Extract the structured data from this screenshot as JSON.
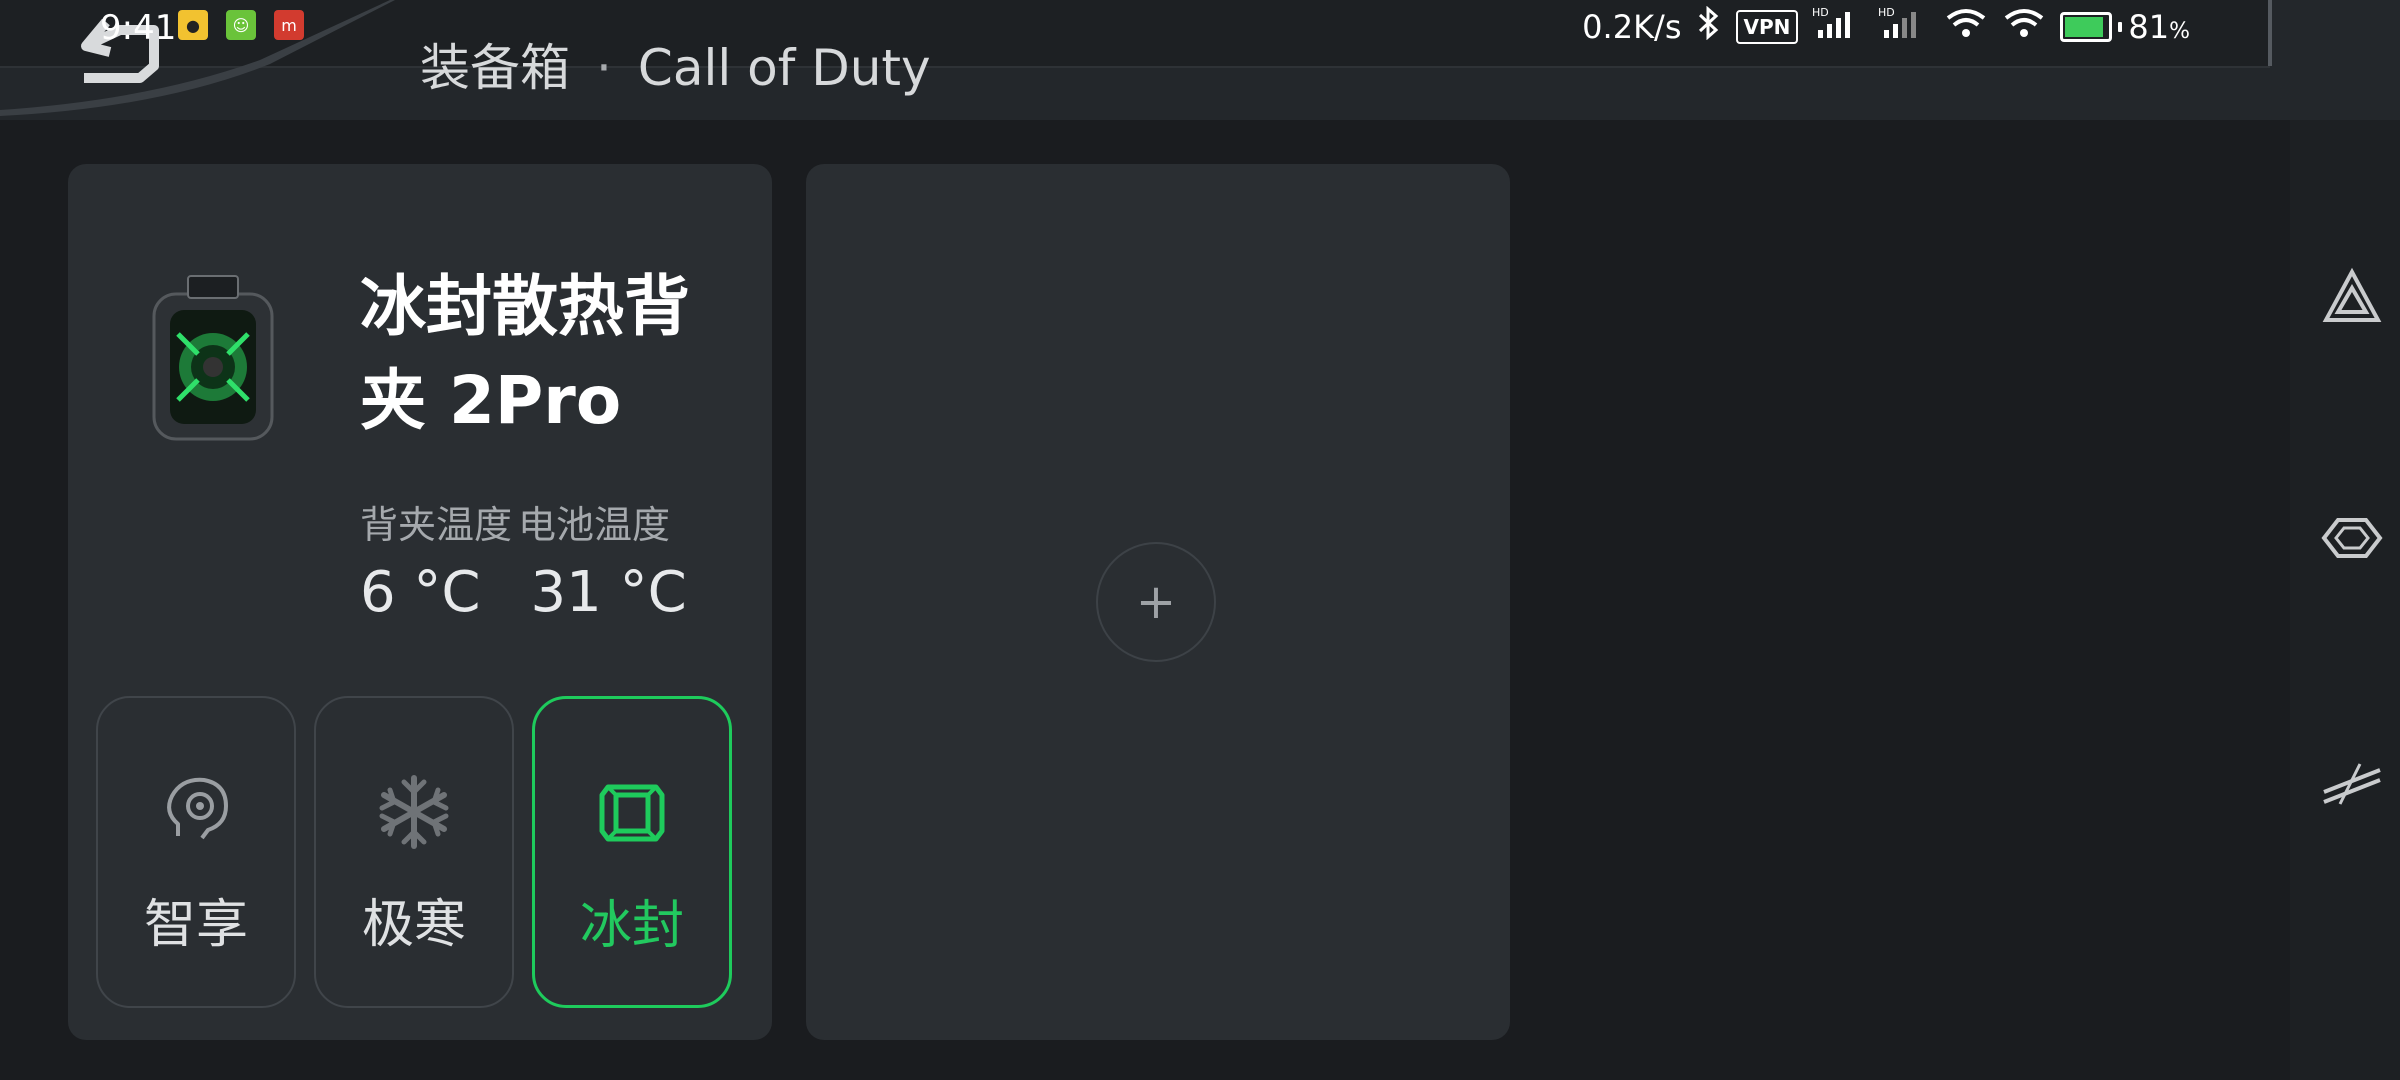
{
  "status_bar": {
    "time": "9:41",
    "net_speed": "0.2K/s",
    "vpn_label": "VPN",
    "signal_tag": "HD",
    "battery_percent": "81",
    "battery_suffix": "%",
    "battery_level": 0.81
  },
  "header": {
    "section": "装备箱",
    "separator": "·",
    "game": "Call of Duty"
  },
  "device_card": {
    "name": "冰封散热背夹 2Pro",
    "temp_labels": [
      "背夹温度",
      "电池温度"
    ],
    "temp_values": [
      "6 °C",
      "31 °C"
    ],
    "modes": [
      {
        "label": "智享",
        "icon": "smart-head-icon",
        "active": false
      },
      {
        "label": "极寒",
        "icon": "snowflake-icon",
        "active": false
      },
      {
        "label": "冰封",
        "icon": "ice-cube-icon",
        "active": true
      }
    ]
  },
  "add_card": {
    "add_symbol": "+"
  },
  "rail": {
    "icons": [
      "triangle-logo-icon",
      "shield-emblem-icon",
      "slash-lines-icon"
    ]
  },
  "colors": {
    "accent": "#1ecb5c",
    "background": "#1a1c1f",
    "card": "#2a2e32"
  }
}
